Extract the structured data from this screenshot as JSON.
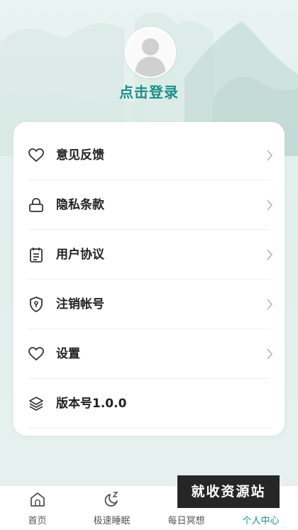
{
  "profile": {
    "login_label": "点击登录"
  },
  "menu": {
    "items": [
      {
        "label": "意见反馈",
        "icon": "heart-icon"
      },
      {
        "label": "隐私条款",
        "icon": "lock-icon"
      },
      {
        "label": "用户协议",
        "icon": "clipboard-icon"
      },
      {
        "label": "注销帐号",
        "icon": "shield-icon"
      },
      {
        "label": "设置",
        "icon": "heart-icon"
      },
      {
        "label": "版本号1.0.0",
        "icon": "layers-icon"
      }
    ]
  },
  "tabbar": {
    "tabs": [
      {
        "label": "首页",
        "icon": "home-icon"
      },
      {
        "label": "极速睡眠",
        "icon": "moon-icon"
      },
      {
        "label": "每日冥想",
        "icon": "meditation-icon"
      },
      {
        "label": "个人中心",
        "icon": "person-icon"
      }
    ],
    "active_index": 3
  },
  "watermark": {
    "text": "就收资源站"
  },
  "colors": {
    "accent": "#1b8f87",
    "background": "#e6f0ed",
    "card": "#ffffff"
  }
}
